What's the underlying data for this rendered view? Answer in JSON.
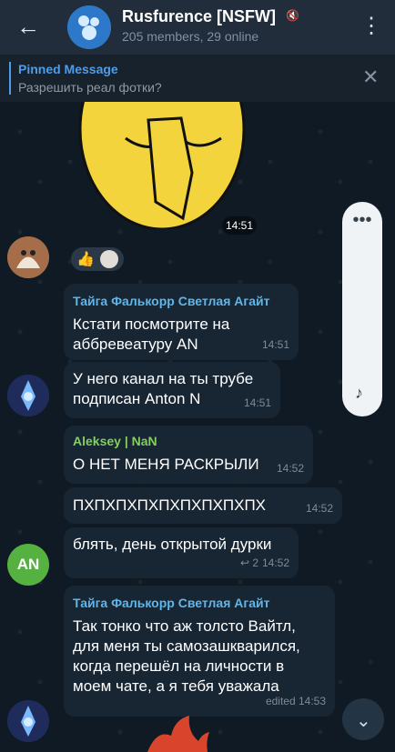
{
  "header": {
    "back_icon": "←",
    "title": "Rusfurence [NSFW]",
    "muted_icon": "🔇",
    "subtitle": "205 members, 29 online",
    "menu_icon": "⋮"
  },
  "pinned": {
    "title": "Pinned Message",
    "text": "Разрешить реал фотки?",
    "close_icon": "✕"
  },
  "messages": [
    {
      "time": "14:51"
    },
    {
      "sender": "Тайга Фалькорр Светлая Агайт",
      "text": "Кстати посмотрите на\nаббревеатуру AN",
      "time": "14:51"
    },
    {
      "text": "У него канал на ты трубе\nподписан Anton N",
      "time": "14:51"
    },
    {
      "sender": "Aleksey | NaN",
      "text": "О НЕТ МЕНЯ РАСКРЫЛИ",
      "time": "14:52"
    },
    {
      "text": "ПХПХПХПХПХПХПХПХПХ",
      "time": "14:52"
    },
    {
      "text": "блять, день открытой дурки",
      "reply_count": "↩ 2",
      "time": "14:52"
    },
    {
      "sender": "Тайга Фалькорр Светлая Агайт",
      "text": "Так тонко что аж толсто Вайтл,\nдля меня ты самозашкварился,\nкогда перешёл на личности в\nмоем чате, а я тебя уважала",
      "edited_time": "edited 14:53"
    }
  ],
  "avatars": {
    "an": "AN"
  },
  "scrollbar": {
    "dots": "•••",
    "note": "♪"
  },
  "fab": {
    "icon": "⌄"
  },
  "colors": {
    "background": "#0e1621",
    "accent": "#4f9de8",
    "bubble": "#182533"
  }
}
